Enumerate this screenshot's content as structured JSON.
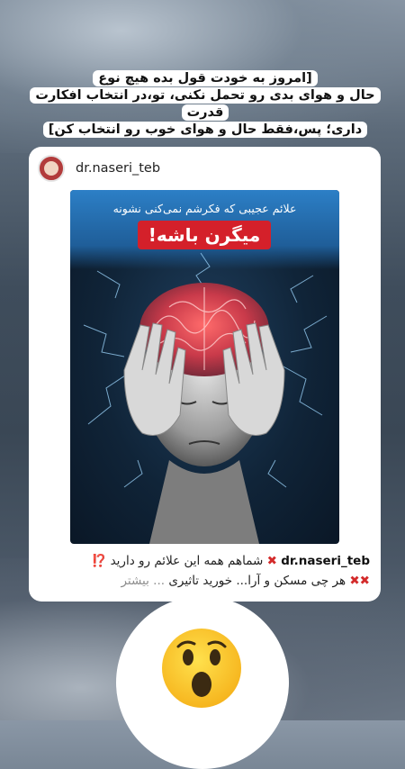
{
  "story": {
    "caption_lines": [
      "[امروز به خودت قول بده هیچ نوع",
      "حال و هوای بدی رو تحمل نکنی، تو،در انتخاب افکارت قدرت",
      "داری؛ پس،فقط حال و هوای خوب رو انتخاب کن]"
    ]
  },
  "post": {
    "username": "dr.naseri_teb",
    "image": {
      "headline": "علائم عجیبی که فکرشم نمی‌کنی نشونه",
      "banner": "میگرن باشه!"
    },
    "caption": {
      "user": "dr.naseri_teb",
      "line1_text": "شماهم همه این علائم رو دارید",
      "line1_mark": "⁉️",
      "line2_text": "هر چی مسکن و آرا...   خورید تاثیری",
      "more": "... بیشتر"
    }
  },
  "reaction": {
    "emoji": "surprised-face"
  },
  "colors": {
    "accent_red": "#d4202a",
    "image_blue": "#2c7fc6"
  }
}
